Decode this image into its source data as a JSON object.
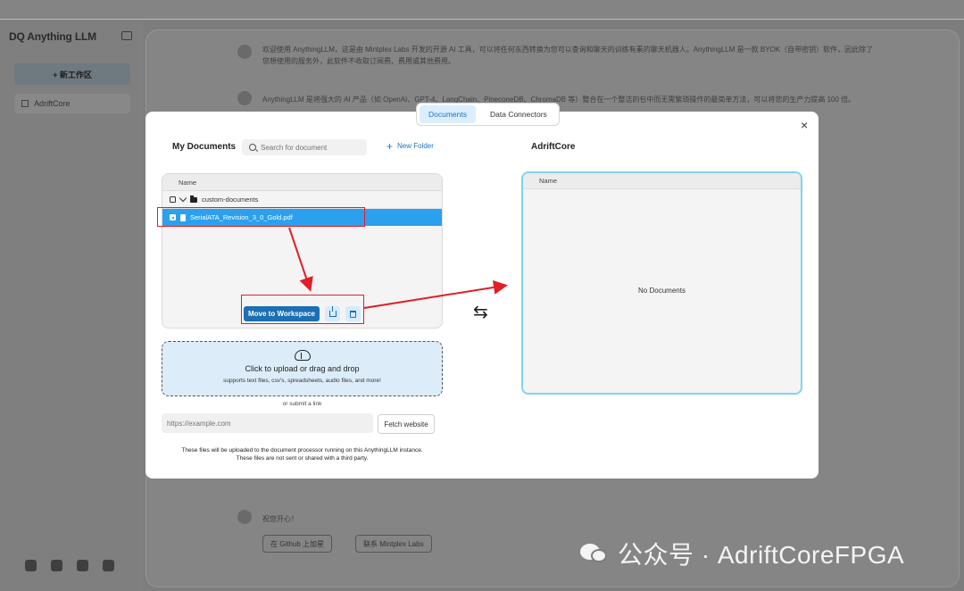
{
  "app": {
    "logo": "DQ Anything LLM",
    "new_workspace": "+ 新工作区",
    "workspace_item": "AdriftCore",
    "chat_lines": [
      "欢迎使用 AnythingLLM，这是由 Mintplex Labs 开发的开源 AI 工具，可以将任何东西转换为您可以查询和聊天的训练有素的聊天机器人。AnythingLLM 是一款 BYOK（自带密钥）软件，因此除了",
      "您想使用的服务外，此软件不收取订阅费、费用或其他费用。",
      "AnythingLLM 是将强大的 AI 产品（如 OpenAI、GPT-4、LangChain、PineconeDB、ChromaDB 等）整合在一个整洁的包中而无需繁琐操作的最简单方法，可以将您的生产力提高 100 倍。"
    ],
    "bottom_line": "祝您开心！",
    "github_btn": "在 Github 上加星",
    "contact_btn": "联系 Mintplex Labs"
  },
  "modal": {
    "tabs": [
      {
        "label": "Documents",
        "active": true
      },
      {
        "label": "Data Connectors",
        "active": false
      }
    ],
    "close": "×",
    "my_documents": {
      "title": "My Documents",
      "search_placeholder": "Search for document",
      "new_folder": "New Folder",
      "column_name": "Name",
      "folder": "custom-documents",
      "file": "SerialATA_Revision_3_0_Gold.pdf",
      "move_button": "Move to Workspace"
    },
    "upload": {
      "title": "Click to upload or drag and drop",
      "subtitle": "supports text files, csv's, spreadsheets, audio files, and more!",
      "or_link": "or submit a link",
      "url_placeholder": "https://example.com",
      "fetch_button": "Fetch website",
      "disclaimer_1": "These files will be uploaded to the document processor running on this AnythingLLM instance.",
      "disclaimer_2": "These files are not sent or shared with a third party."
    },
    "swap": "⇆",
    "workspace": {
      "title": "AdriftCore",
      "column_name": "Name",
      "empty": "No Documents"
    }
  },
  "watermark": "公众号 · AdriftCoreFPGA",
  "colors": {
    "accent": "#1b6fb3",
    "selected_row": "#2ba0ee",
    "annotation": "#e11e26",
    "workspace_border": "#7ed4f0"
  }
}
